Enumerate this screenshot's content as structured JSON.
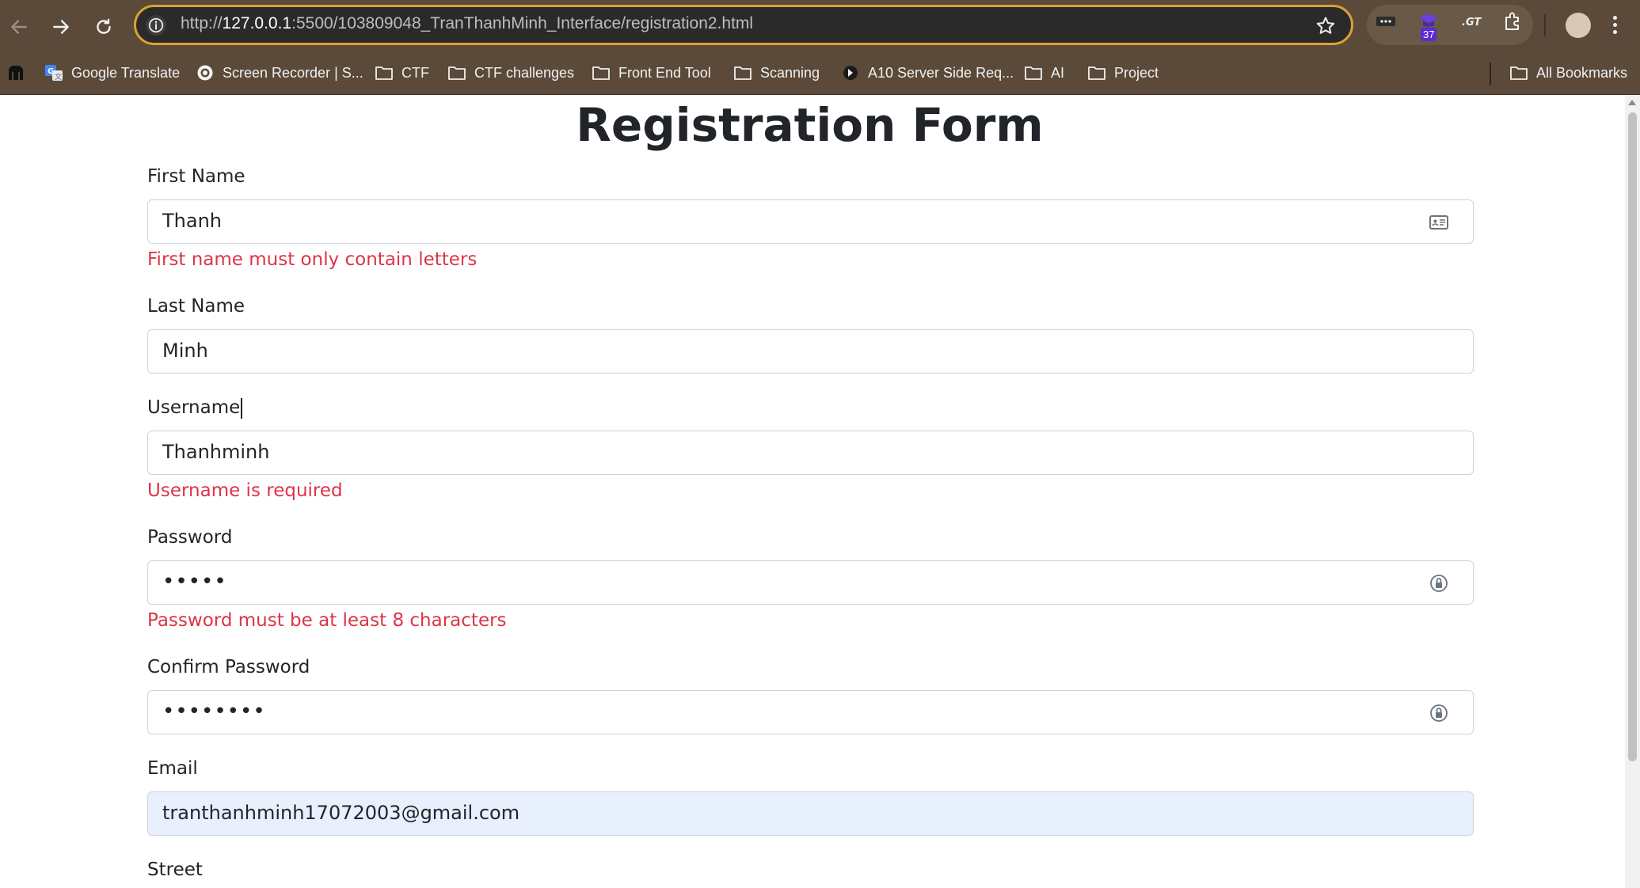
{
  "browser": {
    "url_prefix": "http://",
    "url_host": "127.0.0.1",
    "url_rest": ":5500/103809048_TranThanhMinh_Interface/registration2.html",
    "extension_badge": "37",
    "accent_color": "#d9a233"
  },
  "bookmarks": {
    "items": [
      {
        "label": "Google Translate",
        "icon": "google-translate-icon"
      },
      {
        "label": "Screen Recorder | S...",
        "icon": "screen-recorder-icon"
      },
      {
        "label": "CTF",
        "icon": "folder-icon"
      },
      {
        "label": "CTF challenges",
        "icon": "folder-icon"
      },
      {
        "label": "Front End Tool",
        "icon": "folder-icon"
      },
      {
        "label": "Scanning",
        "icon": "folder-icon"
      },
      {
        "label": "A10 Server Side Req...",
        "icon": "portswigger-icon"
      },
      {
        "label": "AI",
        "icon": "folder-icon"
      },
      {
        "label": "Project",
        "icon": "folder-icon"
      }
    ],
    "all_bookmarks": "All Bookmarks"
  },
  "form": {
    "title": "Registration Form",
    "first_name": {
      "label": "First Name",
      "value": "Thanh",
      "error": "First name must only contain letters"
    },
    "last_name": {
      "label": "Last Name",
      "value": "Minh"
    },
    "username": {
      "label": "Username",
      "value": "Thanhminh",
      "error": "Username is required"
    },
    "password": {
      "label": "Password",
      "value": "•••••",
      "error": "Password must be at least 8 characters"
    },
    "confirm_password": {
      "label": "Confirm Password",
      "value": "••••••••"
    },
    "email": {
      "label": "Email",
      "value": "tranthanhminh17072003@gmail.com"
    },
    "street": {
      "label": "Street"
    },
    "error_color": "#dc3545"
  }
}
